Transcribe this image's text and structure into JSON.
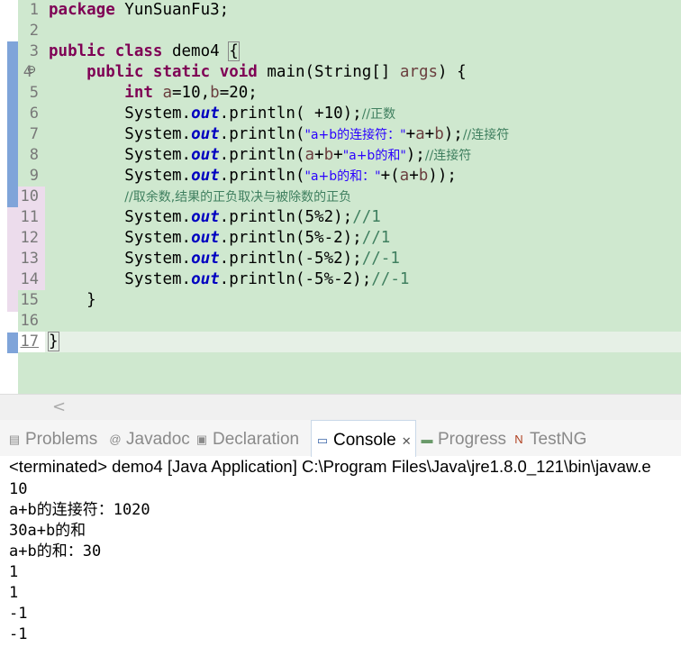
{
  "editor": {
    "line_numbers": [
      "1",
      "2",
      "3",
      "4",
      "5",
      "6",
      "7",
      "8",
      "9",
      "10",
      "11",
      "12",
      "13",
      "14",
      "15",
      "16",
      "17"
    ],
    "line4_marker": "⊖",
    "l1": {
      "kw": "package",
      "rest": " YunSuanFu3;"
    },
    "l3": {
      "kw1": "public",
      "kw2": "class",
      "name": " demo4 ",
      "brace": "{"
    },
    "l4": {
      "kw1": "public",
      "kw2": "static",
      "kw3": "void",
      "rest": " main(String[] ",
      "arg": "args",
      "end": ") {"
    },
    "l5": {
      "kw": "int",
      "a": "a",
      "mid": "=10,",
      "b": "b",
      "end": "=20;"
    },
    "l6": {
      "pre": "System.",
      "out": "out",
      "call": ".println( +10);",
      "cmt": "//正数"
    },
    "l7": {
      "pre": "System.",
      "out": "out",
      "call": ".println(",
      "str": "\"a+b的连接符：\"",
      "plus": "+",
      "a": "a",
      "p2": "+",
      "b": "b",
      "end": ");",
      "cmt": "//连接符"
    },
    "l8": {
      "pre": "System.",
      "out": "out",
      "call": ".println(",
      "a": "a",
      "p1": "+",
      "b": "b",
      "p2": "+",
      "str": "\"a+b的和\"",
      "end": ");",
      "cmt": "//连接符"
    },
    "l9": {
      "pre": "System.",
      "out": "out",
      "call": ".println(",
      "str": "\"a+b的和：\"",
      "mid": "+(",
      "a": "a",
      "p": "+",
      "b": "b",
      "end": "));"
    },
    "l10": {
      "cmt": "//取余数,结果的正负取决与被除数的正负"
    },
    "l11": {
      "pre": "System.",
      "out": "out",
      "call": ".println(5%2);",
      "cmt": "//1"
    },
    "l12": {
      "pre": "System.",
      "out": "out",
      "call": ".println(5%-2);",
      "cmt": "//1"
    },
    "l13": {
      "pre": "System.",
      "out": "out",
      "call": ".println(-5%2);",
      "cmt": "//-1"
    },
    "l14": {
      "pre": "System.",
      "out": "out",
      "call": ".println(-5%-2);",
      "cmt": "//-1"
    },
    "l15": "}",
    "l17": "}"
  },
  "scrollbar": {
    "left_arrow": "<"
  },
  "tabs": [
    {
      "label": "Problems",
      "icon": "problems-icon",
      "glyph": "▤"
    },
    {
      "label": "Javadoc",
      "icon": "javadoc-icon",
      "glyph": "@"
    },
    {
      "label": "Declaration",
      "icon": "declaration-icon",
      "glyph": "▣"
    },
    {
      "label": "Console",
      "icon": "console-icon",
      "glyph": "▭",
      "close": "✕"
    },
    {
      "label": "Progress",
      "icon": "progress-icon",
      "glyph": "▬"
    },
    {
      "label": "TestNG",
      "icon": "testng-icon",
      "glyph": "N"
    }
  ],
  "console": {
    "description": "<terminated> demo4 [Java Application] C:\\Program Files\\Java\\jre1.8.0_121\\bin\\javaw.e",
    "output": [
      "10",
      "a+b的连接符：1020",
      "30a+b的和",
      "a+b的和：30",
      "1",
      "1",
      "-1",
      "-1"
    ]
  },
  "colors": {
    "editor_bg": "#cfe8cf",
    "keyword": "#7f0055",
    "string": "#2a00ff",
    "comment": "#3f7f5f",
    "field": "#0000c0"
  }
}
